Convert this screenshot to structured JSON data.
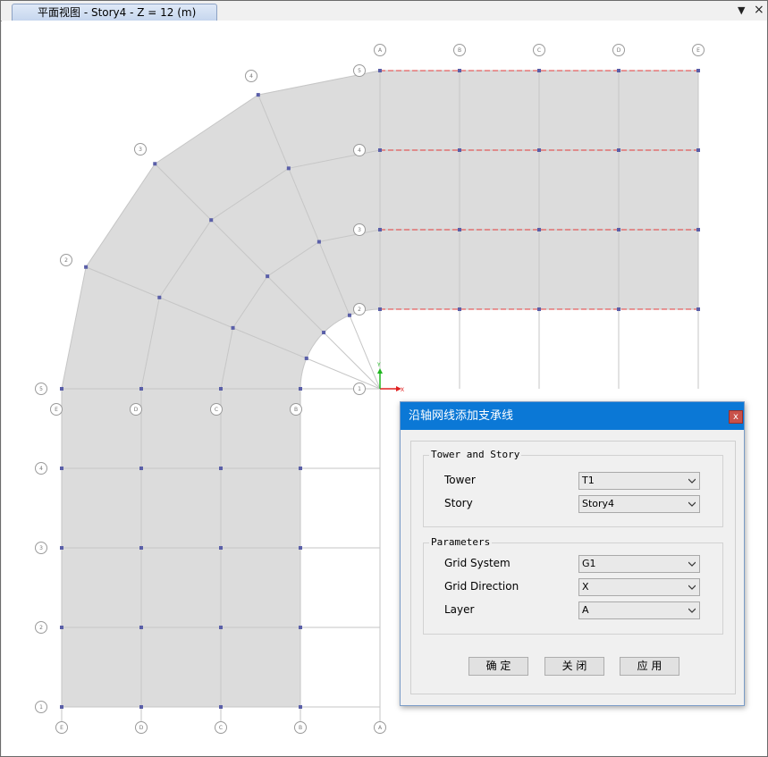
{
  "window": {
    "tab_title": "平面视图 - Story4 - Z = 12 (m)",
    "dropdown_glyph": "▼",
    "close_glyph": "×"
  },
  "plan": {
    "axis_top_labels": [
      "A",
      "B",
      "C",
      "D",
      "E"
    ],
    "axis_bottom_labels": [
      "E",
      "D",
      "C",
      "B",
      "A"
    ],
    "axis_left_labels": [
      "1",
      "2",
      "3",
      "4",
      "5"
    ],
    "axis_right_labels": [
      "5",
      "4",
      "3",
      "2",
      "1"
    ],
    "arc_labels": [
      "4",
      "3",
      "2"
    ],
    "origin_x_label": "X",
    "origin_y_label": "Y",
    "colors": {
      "slab": "#dcdcdc",
      "grid_line": "#c6c6c6",
      "node": "#5a5fa8",
      "support_line": "#e23a3a",
      "axis_x": "#e02020",
      "axis_y": "#1fb51f"
    }
  },
  "dialog": {
    "title": "沿轴网线添加支承线",
    "close_label": "x",
    "group1": {
      "legend": "Tower and Story",
      "tower_label": "Tower",
      "tower_value": "T1",
      "story_label": "Story",
      "story_value": "Story4"
    },
    "group2": {
      "legend": "Parameters",
      "grid_system_label": "Grid System",
      "grid_system_value": "G1",
      "grid_direction_label": "Grid Direction",
      "grid_direction_value": "X",
      "layer_label": "Layer",
      "layer_value": "A"
    },
    "buttons": {
      "ok": "确 定",
      "close": "关 闭",
      "apply": "应 用"
    }
  }
}
